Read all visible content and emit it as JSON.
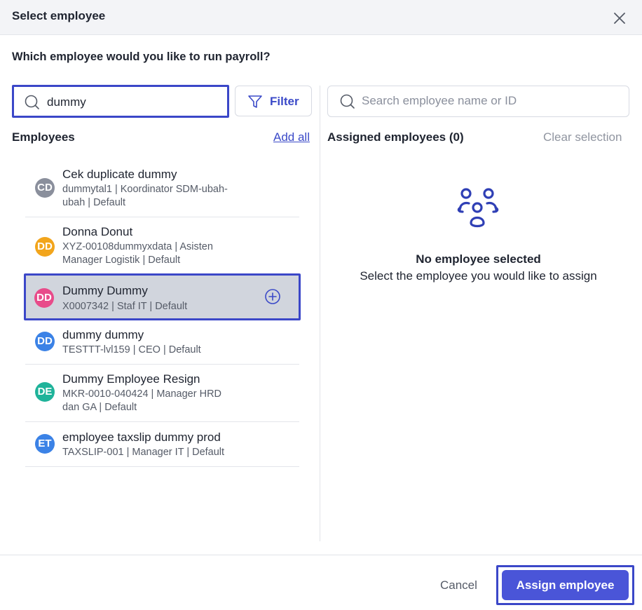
{
  "dialog": {
    "title": "Select employee",
    "question": "Which employee would you like to run payroll?"
  },
  "left": {
    "search_value": "dummy",
    "filter_label": "Filter",
    "section_title": "Employees",
    "add_all_label": "Add all",
    "employees": [
      {
        "initials": "CD",
        "name": "Cek duplicate dummy",
        "meta_line1": "dummytal1 | Koordinator SDM-ubah-",
        "meta_line2": "ubah | Default",
        "avatar_color": "#8a8f9c"
      },
      {
        "initials": "DD",
        "name": "Donna Donut",
        "meta_line1": "XYZ-00108dummyxdata | Asisten",
        "meta_line2": "Manager Logistik | Default",
        "avatar_color": "#f2a51c"
      },
      {
        "initials": "DD",
        "name": "Dummy Dummy",
        "meta_line1": "X0007342 | Staf IT | Default",
        "meta_line2": "",
        "avatar_color": "#e84b8a"
      },
      {
        "initials": "DD",
        "name": "dummy dummy",
        "meta_line1": "TESTTT-lvl159 | CEO | Default",
        "meta_line2": "",
        "avatar_color": "#3b82e6"
      },
      {
        "initials": "DE",
        "name": "Dummy Employee Resign",
        "meta_line1": "MKR-0010-040424 | Manager HRD",
        "meta_line2": "dan GA | Default",
        "avatar_color": "#1fb39a"
      },
      {
        "initials": "ET",
        "name": "employee taxslip dummy prod",
        "meta_line1": "TAXSLIP-001 | Manager IT | Default",
        "meta_line2": "",
        "avatar_color": "#3b82e6"
      }
    ]
  },
  "right": {
    "search_placeholder": "Search employee name or ID",
    "section_title": "Assigned employees (0)",
    "clear_label": "Clear selection",
    "empty_title": "No employee selected",
    "empty_subtitle": "Select the employee you would like to assign"
  },
  "footer": {
    "cancel_label": "Cancel",
    "assign_label": "Assign employee"
  },
  "colors": {
    "accent": "#3b4ac8",
    "primary_button": "#4a55d8",
    "highlight_border": "#3b47c8",
    "selected_row": "#d1d5dd"
  }
}
